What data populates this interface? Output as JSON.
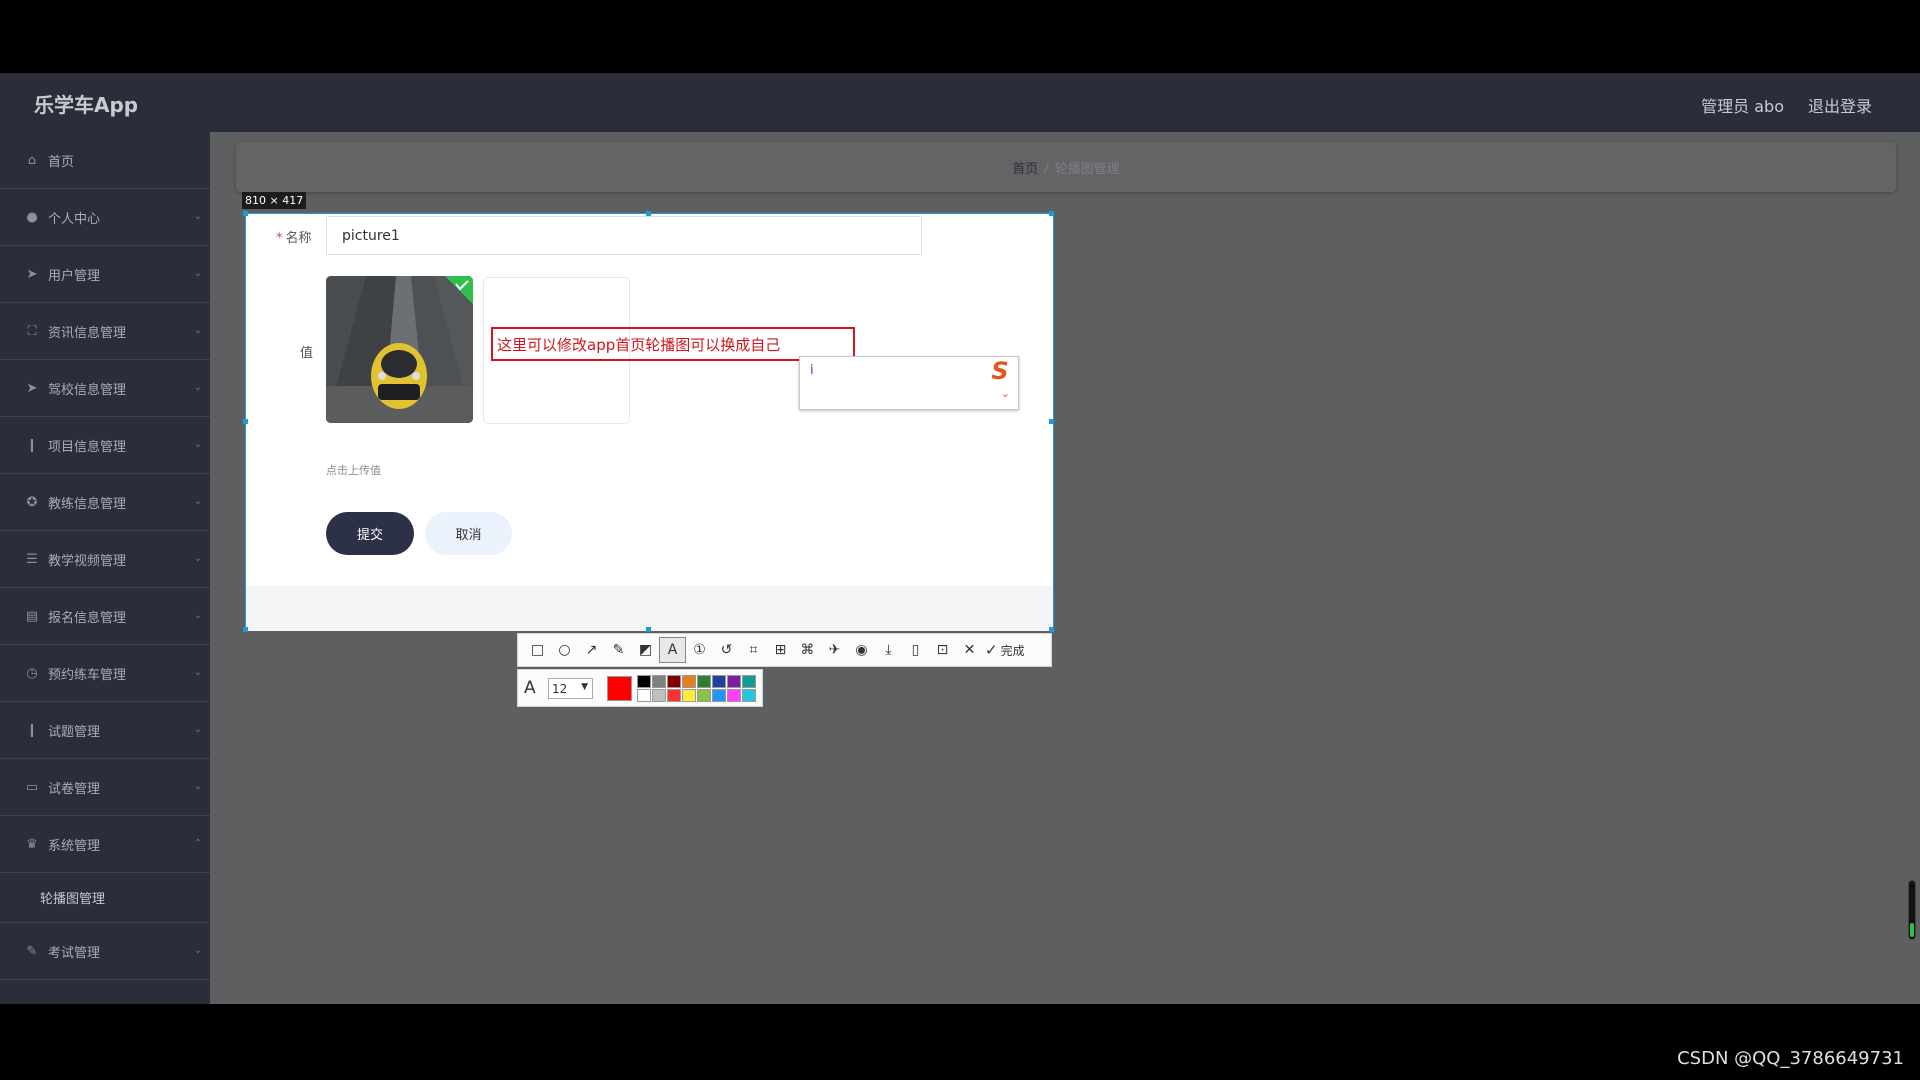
{
  "app": {
    "title": "乐学车App",
    "user": "管理员 abo",
    "logout": "退出登录"
  },
  "sidebar": {
    "items": [
      {
        "label": "首页",
        "icon": "home-icon"
      },
      {
        "label": "个人中心",
        "icon": "user-icon"
      },
      {
        "label": "用户管理",
        "icon": "send-icon"
      },
      {
        "label": "资讯信息管理",
        "icon": "frame-icon"
      },
      {
        "label": "驾校信息管理",
        "icon": "send-icon"
      },
      {
        "label": "项目信息管理",
        "icon": "mic-icon"
      },
      {
        "label": "教练信息管理",
        "icon": "badge-icon"
      },
      {
        "label": "教学视频管理",
        "icon": "list-icon"
      },
      {
        "label": "报名信息管理",
        "icon": "chat-icon"
      },
      {
        "label": "预约练车管理",
        "icon": "clock-icon"
      },
      {
        "label": "试题管理",
        "icon": "mic-icon"
      },
      {
        "label": "试卷管理",
        "icon": "message-icon"
      },
      {
        "label": "系统管理",
        "icon": "trophy-icon"
      },
      {
        "label": "考试管理",
        "icon": "edit-icon"
      }
    ],
    "submenu": "轮播图管理"
  },
  "breadcrumb": {
    "home": "首页",
    "sep": "/",
    "current": "轮播图管理"
  },
  "capture": {
    "size_label": "810 × 417"
  },
  "form": {
    "name_label": "名称",
    "required_mark": "*",
    "name_value": "picture1",
    "value_label": "值",
    "upload_hint": "点击上传值",
    "submit": "提交",
    "cancel": "取消"
  },
  "annotation": {
    "text": "这里可以修改app首页轮播图可以换成自己"
  },
  "ime": {
    "typed": "i"
  },
  "toolbar": {
    "done": "完成",
    "font_size": "12",
    "current_color": "#ff0000",
    "palette": [
      "#000000",
      "#808080",
      "#800000",
      "#e67e22",
      "#2e7d32",
      "#1f3fa3",
      "#7b1fa2",
      "#129a9a",
      "#ffffff",
      "#c0c0c0",
      "#ff3030",
      "#ffeb3b",
      "#8bc34a",
      "#2196f3",
      "#ff40ff",
      "#26c6da"
    ]
  },
  "watermark": "CSDN @QQ_3786649731"
}
